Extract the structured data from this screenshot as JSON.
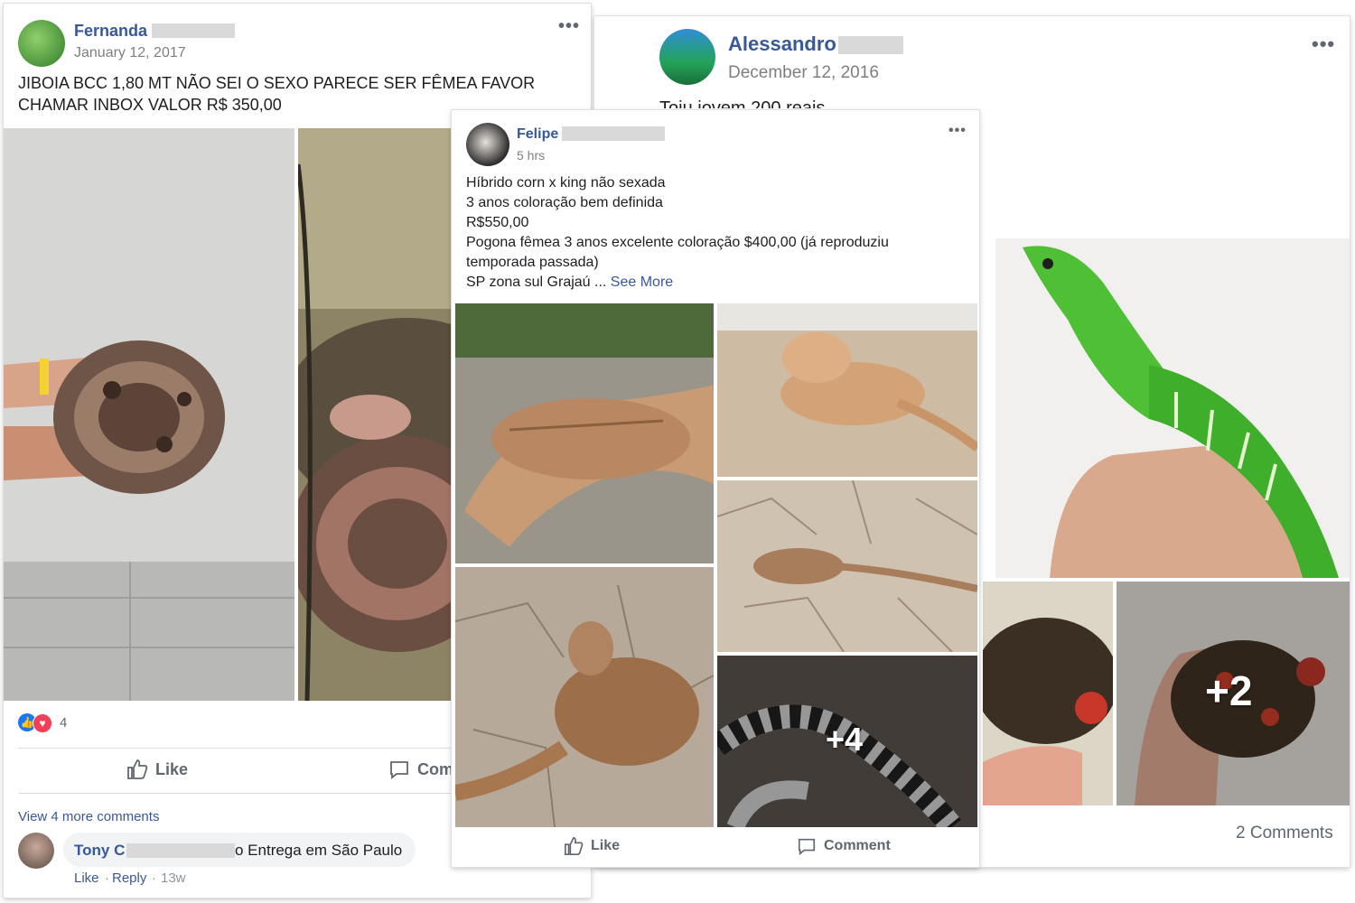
{
  "post_fernanda": {
    "author": "Fernanda",
    "date": "January 12, 2017",
    "text_line1": "JIBOIA BCC 1,80 MT NÃO SEI O SEXO PARECE SER FÊMEA FAVOR",
    "text_line2": "CHAMAR INBOX VALOR R$ 350,00",
    "reaction_count": "4",
    "like_label": "Like",
    "comment_label": "Com",
    "view_more_comments": "View 4 more comments",
    "comment": {
      "author": "Tony C",
      "text": "o Entrega em São Paulo",
      "like": "Like",
      "reply": "Reply",
      "time": "13w"
    },
    "menu_icon": "more-options-icon"
  },
  "post_alessandro": {
    "author": "Alessandro",
    "date": "December 12, 2016",
    "text_fragment": "Toju jovem 200 reais",
    "overlay_count": "+2",
    "comments_count": "2 Comments",
    "menu_icon": "more-options-icon"
  },
  "post_felipe": {
    "author": "Felipe",
    "date": "5 hrs",
    "lines": [
      "Híbrido corn x king não sexada",
      "3 anos coloração bem definida",
      "R$550,00",
      "Pogona fêmea 3 anos excelente coloração $400,00 (já reproduziu",
      "temporada passada)"
    ],
    "last_line": "SP zona sul Grajaú ...",
    "see_more": "See More",
    "overlay_count": "+4",
    "like_label": "Like",
    "comment_label": "Comment",
    "menu_icon": "more-options-icon"
  },
  "colors": {
    "facebook_blue": "#385898",
    "like_blue": "#1877f2",
    "love_red": "#f33e58",
    "muted_text": "#606770"
  }
}
